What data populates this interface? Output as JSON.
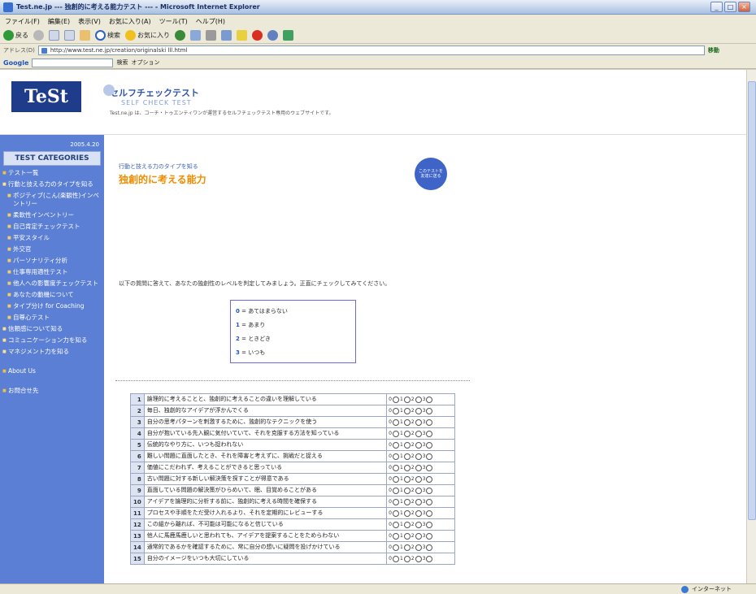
{
  "window": {
    "title": "Test.ne.jp --- 独創的に考える能力テスト --- - Microsoft Internet Explorer"
  },
  "menu": [
    "ファイル(F)",
    "編集(E)",
    "表示(V)",
    "お気に入り(A)",
    "ツール(T)",
    "ヘルプ(H)"
  ],
  "toolbar": {
    "back": "戻る",
    "search": "検索",
    "favorites": "お気に入り"
  },
  "address": {
    "label": "アドレス(D)",
    "url": "http://www.test.ne.jp/creation/originalski lll.html",
    "go": "移動"
  },
  "google": {
    "label": "Google",
    "search_btn": "検索",
    "options": "オプション"
  },
  "status": {
    "zone": "インターネット"
  },
  "site": {
    "logo_text": "TeSt",
    "brand_jp": "セルフチェックテスト",
    "brand_en": "SELF CHECK TEST",
    "desc": "Test.ne.jp は、コーチ・トゥエンティワンが運営するセルフチェックテスト専用のウェブサイトです。"
  },
  "sidebar": {
    "date": "2005.4.20",
    "category_header": "TEST CATEGORIES",
    "items": [
      {
        "label": "テスト一覧",
        "level": "top"
      },
      {
        "label": "行動と技える力のタイプを知る",
        "level": "sect"
      },
      {
        "label": "ポジティブ(こん(楽観性)インベントリー",
        "level": "sub"
      },
      {
        "label": "柔軟性インベントリー",
        "level": "sub"
      },
      {
        "label": "自己肯定チェックテスト",
        "level": "sub"
      },
      {
        "label": "平安スタイル",
        "level": "sub"
      },
      {
        "label": "外交官",
        "level": "sub"
      },
      {
        "label": "パーソナリティ分析",
        "level": "sub"
      },
      {
        "label": "仕事専用適性テスト",
        "level": "sub"
      },
      {
        "label": "他人への影響度チェックテスト",
        "level": "sub"
      },
      {
        "label": "あなたの動機について",
        "level": "sub"
      },
      {
        "label": "タイプ分け for Coaching",
        "level": "sub"
      },
      {
        "label": "自尊心テスト",
        "level": "sub"
      },
      {
        "label": "信頼感について知る",
        "level": "sect"
      },
      {
        "label": "コミュニケーション力を知る",
        "level": "sect"
      },
      {
        "label": "マネジメント力を知る",
        "level": "sect"
      },
      {
        "label": "About Us",
        "level": "top"
      },
      {
        "label": "お問合せ先",
        "level": "top"
      }
    ]
  },
  "main": {
    "breadcrumb": "行動と技える力のタイプを知る",
    "title": "独創的に考える能力",
    "circle_text": "このテストを友達に送る",
    "instruction": "以下の質問に答えて、あなたの独創性のレベルを判定してみましょう。正直にチェックしてみてください。",
    "legend": [
      {
        "num": "0",
        "text": "あてはまらない"
      },
      {
        "num": "1",
        "text": "あまり"
      },
      {
        "num": "2",
        "text": "ときどき"
      },
      {
        "num": "3",
        "text": "いつも"
      }
    ],
    "option_numbers": [
      "0",
      "1",
      "2",
      "3"
    ],
    "questions": [
      {
        "no": "1",
        "text": "論理的に考えることと、独創的に考えることの違いを理解している"
      },
      {
        "no": "2",
        "text": "毎日、独創的なアイデアが浮かんでくる"
      },
      {
        "no": "3",
        "text": "自分の思考パターンを刺激するために、独創的なテクニックを使う"
      },
      {
        "no": "4",
        "text": "自分が抱いている先入観に気付いていて、それを克服する方法を知っている"
      },
      {
        "no": "5",
        "text": "伝統的なやり方に、いつも捉われない"
      },
      {
        "no": "6",
        "text": "難しい問題に直面したとき、それを障害と考えずに、挑戦だと捉える"
      },
      {
        "no": "7",
        "text": "価値にこだわれず、考えることができると思っている"
      },
      {
        "no": "8",
        "text": "古い問題に対する新しい解決策を探すことが得意である"
      },
      {
        "no": "9",
        "text": "直面している問題の解決策がひらめいて、眠、目覚めることがある"
      },
      {
        "no": "10",
        "text": "アイデアを論理的に分析する前に、独創的に考える時間を確保する"
      },
      {
        "no": "11",
        "text": "プロセスや手順をただ受け入れるより、それを定期的にレビューする"
      },
      {
        "no": "12",
        "text": "この組から離れば、不可能は可能になると信じている"
      },
      {
        "no": "13",
        "text": "他人に馬鹿馬鹿しいと思われても、アイデアを提案することをためらわない"
      },
      {
        "no": "14",
        "text": "通常的であるかを確認するために、常に自分の想いに疑問を投げかけている"
      },
      {
        "no": "15",
        "text": "自分のイメージをいつも大切にしている"
      }
    ]
  }
}
